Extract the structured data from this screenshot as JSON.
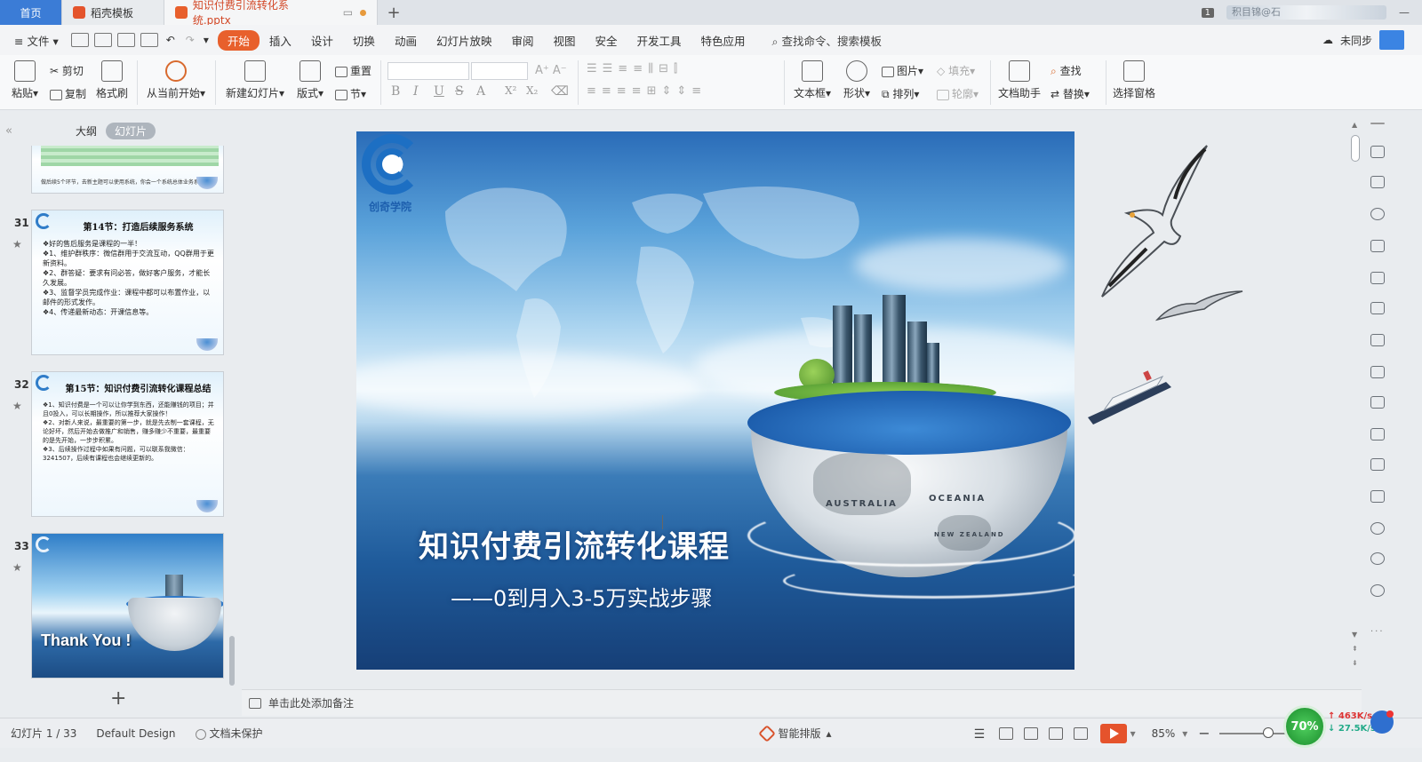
{
  "tabs": {
    "home": "首页",
    "templates": "稻壳模板",
    "document": "知识付费引流转化系统.pptx",
    "add": "+",
    "window_count": "1",
    "user": "积目锦@石"
  },
  "menu": {
    "file": "文件",
    "items": [
      "开始",
      "插入",
      "设计",
      "切换",
      "动画",
      "幻灯片放映",
      "审阅",
      "视图",
      "安全",
      "开发工具",
      "特色应用"
    ],
    "search": "查找命令、搜索模板",
    "sync": "未同步"
  },
  "ribbon": {
    "paste": "粘贴",
    "cut": "剪切",
    "copy": "复制",
    "format_painter": "格式刷",
    "from_current": "从当前开始",
    "new_slide": "新建幻灯片",
    "layout": "版式",
    "reset": "重置",
    "section": "节",
    "textbox": "文本框",
    "shape": "形状",
    "picture": "图片",
    "fill": "填充",
    "arrange": "排列",
    "outline": "轮廓",
    "doc_assistant": "文档助手",
    "find": "查找",
    "replace": "替换",
    "select_pane": "选择窗格"
  },
  "left_panel": {
    "tab_outline": "大纲",
    "tab_slides": "幻灯片",
    "add": "+",
    "thumbnails": [
      {
        "number": "",
        "caption": "做后续5个环节，去新主题可以使用系统，你会一个系统总体业务系统。"
      },
      {
        "number": "31",
        "title": "第14节：打造后续服务系统",
        "lines": [
          "❖好的售后服务是课程的一半！",
          "❖1、维护群秩序：微信群用于交流互动，QQ群用于更新资料。",
          "❖2、群答疑：要求有问必答，做好客户服务，才能长久发展。",
          "❖3、监督学员完成作业：课程中都可以布置作业，以邮件的形式发作。",
          "❖4、传递最新动态：开课信息等。"
        ]
      },
      {
        "number": "32",
        "title": "第15节：知识付费引流转化课程总结",
        "lines": [
          "❖1、知识付费是一个可以让你学到东西，还能赚钱的项目；并且0投入，可以长期操作，所以推荐大家操作！",
          "❖2、对新人来说，最重要的第一步，就是先去制一套课程，无论好坏，然后开始去做推广和销售，赚多赚少不重要，最重要的是先开始，一步步积累。",
          "❖3、后续操作过程中如果有问题，可以联系我微信：3241507，后续有课程也会继续更新的。"
        ]
      },
      {
        "number": "33",
        "title": "Thank You !"
      }
    ]
  },
  "slide": {
    "logo_text": "创奇学院",
    "title": "知识付费引流转化课程",
    "subtitle": "——0到月入3-5万实战步骤",
    "globe_label_1": "AUSTRALIA",
    "globe_label_2": "OCEANIA",
    "globe_label_3": "NEW ZEALAND"
  },
  "notes_placeholder": "单击此处添加备注",
  "status": {
    "slide_counter": "幻灯片 1 / 33",
    "theme": "Default Design",
    "protect": "文档未保护",
    "smart_layout": "智能排版",
    "zoom": "85%",
    "zoom_fraction": 0.5,
    "perf": "70%",
    "upload_speed": "463K/s",
    "download_speed": "27.5K/s"
  },
  "colors": {
    "accent": "#e8602c",
    "tab_home": "#3b7cd6",
    "doc_tab_text": "#d24726",
    "perf_green": "#2aa03b"
  }
}
